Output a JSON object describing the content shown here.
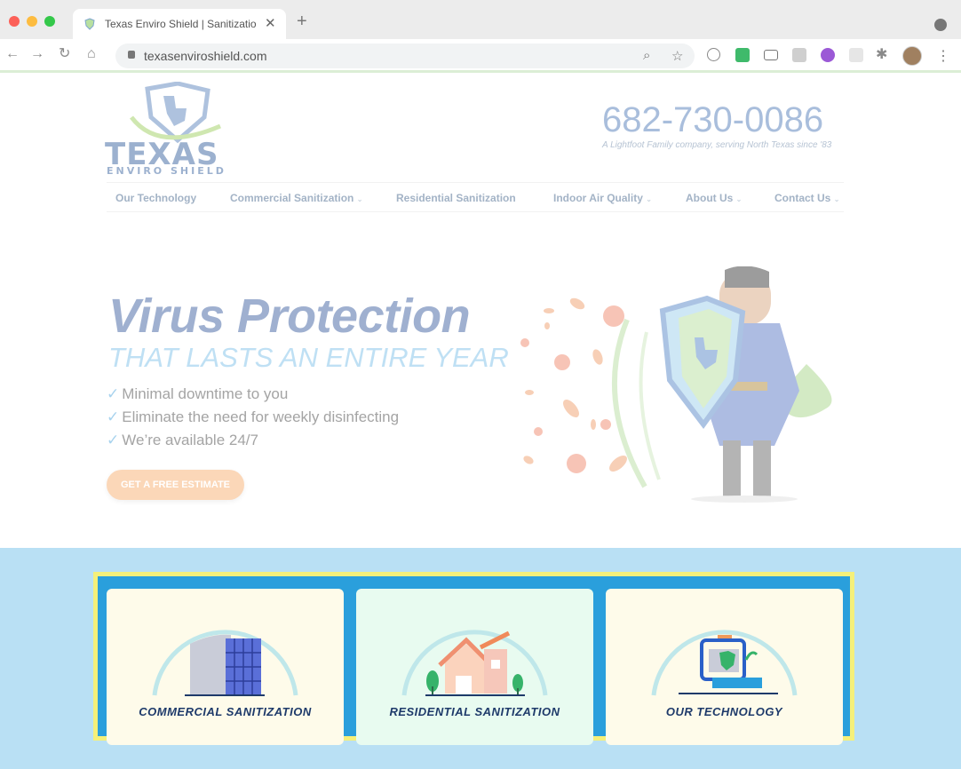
{
  "browser": {
    "tab_title": "Texas Enviro Shield | Sanitizatio",
    "tab_close": "✕",
    "new_tab": "+",
    "url": "texasenviroshield.com",
    "icons": [
      "back-icon",
      "forward-icon",
      "reload-icon",
      "home-icon",
      "lock-icon",
      "zoom-icon",
      "star-icon",
      "extension-icons",
      "puzzle-icon",
      "profile-avatar",
      "menu-icon"
    ]
  },
  "site": {
    "logo": {
      "word": "TEXAS",
      "sub": "ENVIRO SHIELD"
    },
    "phone": "682-730-0086",
    "tagline": "A Lightfoot Family company, serving North Texas since '83",
    "nav": [
      {
        "label": "Our Technology",
        "has_dropdown": false
      },
      {
        "label": "Commercial Sanitization",
        "has_dropdown": true
      },
      {
        "label": "Residential Sanitization",
        "has_dropdown": false
      },
      {
        "label": "Indoor Air Quality",
        "has_dropdown": true
      },
      {
        "label": "About Us",
        "has_dropdown": true
      },
      {
        "label": "Contact Us",
        "has_dropdown": true
      }
    ],
    "hero": {
      "title": "Virus Protection",
      "subtitle": "THAT LASTS AN ENTIRE YEAR",
      "bullets": [
        "Minimal downtime to you",
        "Eliminate the need for weekly disinfecting",
        "We’re available 24/7"
      ],
      "cta": "GET A FREE ESTIMATE"
    },
    "cards": [
      {
        "label": "COMMERCIAL SANITIZATION",
        "icon": "building-icon"
      },
      {
        "label": "RESIDENTIAL SANITIZATION",
        "icon": "house-icon"
      },
      {
        "label": "OUR TECHNOLOGY",
        "icon": "sprayer-machine-icon"
      }
    ]
  },
  "colors": {
    "band": "#b9e0f4",
    "highlight_border": "#f5f07a",
    "frame_bg": "#2a9fdc",
    "card_commercial": "#fefbea",
    "card_residential": "#e8fbf0",
    "card_technology": "#fefbea",
    "cta": "#fbd7b8"
  }
}
